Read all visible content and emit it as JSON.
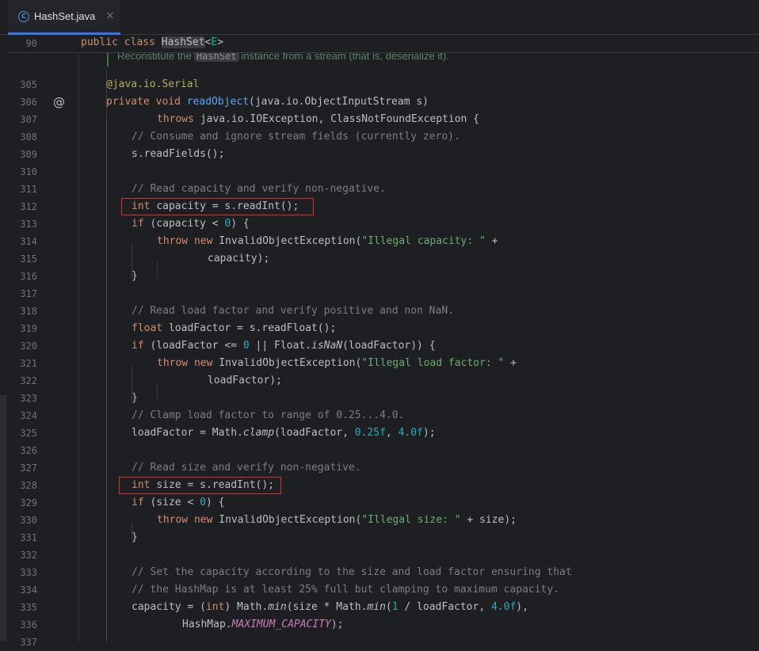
{
  "tab": {
    "icon_letter": "C",
    "title": "HashSet.java",
    "close_glyph": "×"
  },
  "icons": {
    "tab_icon": "java-class-icon",
    "gutter_icon": "override-marker-icon",
    "gutter_glyph": "@"
  },
  "colors": {
    "accent": "#3574f0",
    "highlight_box": "#d9312b"
  },
  "sticky": {
    "line_number": "90",
    "code": [
      {
        "t": "public class ",
        "c": "kw"
      },
      {
        "t": "HashSet",
        "c": "cls-hl"
      },
      {
        "t": "<"
      },
      {
        "t": "E",
        "c": "tparam"
      },
      {
        "t": ">"
      }
    ]
  },
  "doc_comment": {
    "prefix": "Reconstitute the",
    "code_ref": "HashSet",
    "suffix": "instance from a stream (that is, deserialize it)."
  },
  "lines": [
    {
      "n": "305",
      "i": 0,
      "t": [
        {
          "t": "@java.io.Serial",
          "c": "ann"
        }
      ]
    },
    {
      "n": "306",
      "i": 0,
      "t": [
        {
          "t": "private void ",
          "c": "kw"
        },
        {
          "t": "readObject",
          "c": "fn"
        },
        {
          "t": "(java.io.ObjectInputStream s)"
        }
      ]
    },
    {
      "n": "307",
      "i": 2,
      "t": [
        {
          "t": "throws ",
          "c": "kw"
        },
        {
          "t": "java.io.IOException, ClassNotFoundException {"
        }
      ]
    },
    {
      "n": "308",
      "i": 1,
      "t": [
        {
          "t": "// Consume and ignore stream fields (currently zero).",
          "c": "cm"
        }
      ]
    },
    {
      "n": "309",
      "i": 1,
      "t": [
        {
          "t": "s.readFields();"
        }
      ]
    },
    {
      "n": "310",
      "i": 0,
      "t": []
    },
    {
      "n": "311",
      "i": 1,
      "t": [
        {
          "t": "// Read capacity and verify non-negative.",
          "c": "cm"
        }
      ]
    },
    {
      "n": "312",
      "i": 1,
      "t": [
        {
          "t": "int ",
          "c": "kw"
        },
        {
          "t": "capacity = s.readInt();"
        }
      ]
    },
    {
      "n": "313",
      "i": 1,
      "t": [
        {
          "t": "if ",
          "c": "kw"
        },
        {
          "t": "(capacity < "
        },
        {
          "t": "0",
          "c": "num"
        },
        {
          "t": ") {"
        }
      ]
    },
    {
      "n": "314",
      "i": 2,
      "t": [
        {
          "t": "throw new ",
          "c": "kw"
        },
        {
          "t": "InvalidObjectException("
        },
        {
          "t": "\"Illegal capacity: \"",
          "c": "str"
        },
        {
          "t": " +"
        }
      ]
    },
    {
      "n": "315",
      "i": 4,
      "t": [
        {
          "t": "capacity);"
        }
      ]
    },
    {
      "n": "316",
      "i": 1,
      "t": [
        {
          "t": "}"
        }
      ]
    },
    {
      "n": "317",
      "i": 0,
      "t": []
    },
    {
      "n": "318",
      "i": 1,
      "t": [
        {
          "t": "// Read load factor and verify positive and non NaN.",
          "c": "cm"
        }
      ]
    },
    {
      "n": "319",
      "i": 1,
      "t": [
        {
          "t": "float ",
          "c": "kw"
        },
        {
          "t": "loadFactor = s.readFloat();"
        }
      ]
    },
    {
      "n": "320",
      "i": 1,
      "t": [
        {
          "t": "if ",
          "c": "kw"
        },
        {
          "t": "(loadFactor <= "
        },
        {
          "t": "0",
          "c": "num"
        },
        {
          "t": " || Float."
        },
        {
          "t": "isNaN",
          "c": "it"
        },
        {
          "t": "(loadFactor)) {"
        }
      ]
    },
    {
      "n": "321",
      "i": 2,
      "t": [
        {
          "t": "throw new ",
          "c": "kw"
        },
        {
          "t": "InvalidObjectException("
        },
        {
          "t": "\"Illegal load factor: \"",
          "c": "str"
        },
        {
          "t": " +"
        }
      ]
    },
    {
      "n": "322",
      "i": 4,
      "t": [
        {
          "t": "loadFactor);"
        }
      ]
    },
    {
      "n": "323",
      "i": 1,
      "t": [
        {
          "t": "}"
        }
      ]
    },
    {
      "n": "324",
      "i": 1,
      "t": [
        {
          "t": "// Clamp load factor to range of 0.25...4.0.",
          "c": "cm"
        }
      ]
    },
    {
      "n": "325",
      "i": 1,
      "t": [
        {
          "t": "loadFactor = Math."
        },
        {
          "t": "clamp",
          "c": "it"
        },
        {
          "t": "(loadFactor, "
        },
        {
          "t": "0.25f",
          "c": "num"
        },
        {
          "t": ", "
        },
        {
          "t": "4.0f",
          "c": "num"
        },
        {
          "t": ");"
        }
      ]
    },
    {
      "n": "326",
      "i": 0,
      "t": []
    },
    {
      "n": "327",
      "i": 1,
      "t": [
        {
          "t": "// Read size and verify non-negative.",
          "c": "cm"
        }
      ]
    },
    {
      "n": "328",
      "i": 1,
      "t": [
        {
          "t": "int ",
          "c": "kw"
        },
        {
          "t": "size = s.readInt();"
        }
      ]
    },
    {
      "n": "329",
      "i": 1,
      "t": [
        {
          "t": "if ",
          "c": "kw"
        },
        {
          "t": "(size < "
        },
        {
          "t": "0",
          "c": "num"
        },
        {
          "t": ") {"
        }
      ]
    },
    {
      "n": "330",
      "i": 2,
      "t": [
        {
          "t": "throw new ",
          "c": "kw"
        },
        {
          "t": "InvalidObjectException("
        },
        {
          "t": "\"Illegal size: \"",
          "c": "str"
        },
        {
          "t": " + size);"
        }
      ]
    },
    {
      "n": "331",
      "i": 1,
      "t": [
        {
          "t": "}"
        }
      ]
    },
    {
      "n": "332",
      "i": 0,
      "t": []
    },
    {
      "n": "333",
      "i": 1,
      "t": [
        {
          "t": "// Set the capacity according to the size and load factor ensuring that",
          "c": "cm"
        }
      ]
    },
    {
      "n": "334",
      "i": 1,
      "t": [
        {
          "t": "// the HashMap is at least 25% full but clamping to maximum capacity.",
          "c": "cm"
        }
      ]
    },
    {
      "n": "335",
      "i": 1,
      "t": [
        {
          "t": "capacity = ("
        },
        {
          "t": "int",
          "c": "kw"
        },
        {
          "t": ") Math."
        },
        {
          "t": "min",
          "c": "it"
        },
        {
          "t": "(size * Math."
        },
        {
          "t": "min",
          "c": "it"
        },
        {
          "t": "("
        },
        {
          "t": "1",
          "c": "num"
        },
        {
          "t": " / loadFactor, "
        },
        {
          "t": "4.0f",
          "c": "num"
        },
        {
          "t": "),"
        }
      ]
    },
    {
      "n": "336",
      "i": 3,
      "t": [
        {
          "t": "HashMap."
        },
        {
          "t": "MAXIMUM_CAPACITY",
          "c": "const"
        },
        {
          "t": ");"
        }
      ]
    },
    {
      "n": "337",
      "i": 0,
      "t": []
    }
  ]
}
